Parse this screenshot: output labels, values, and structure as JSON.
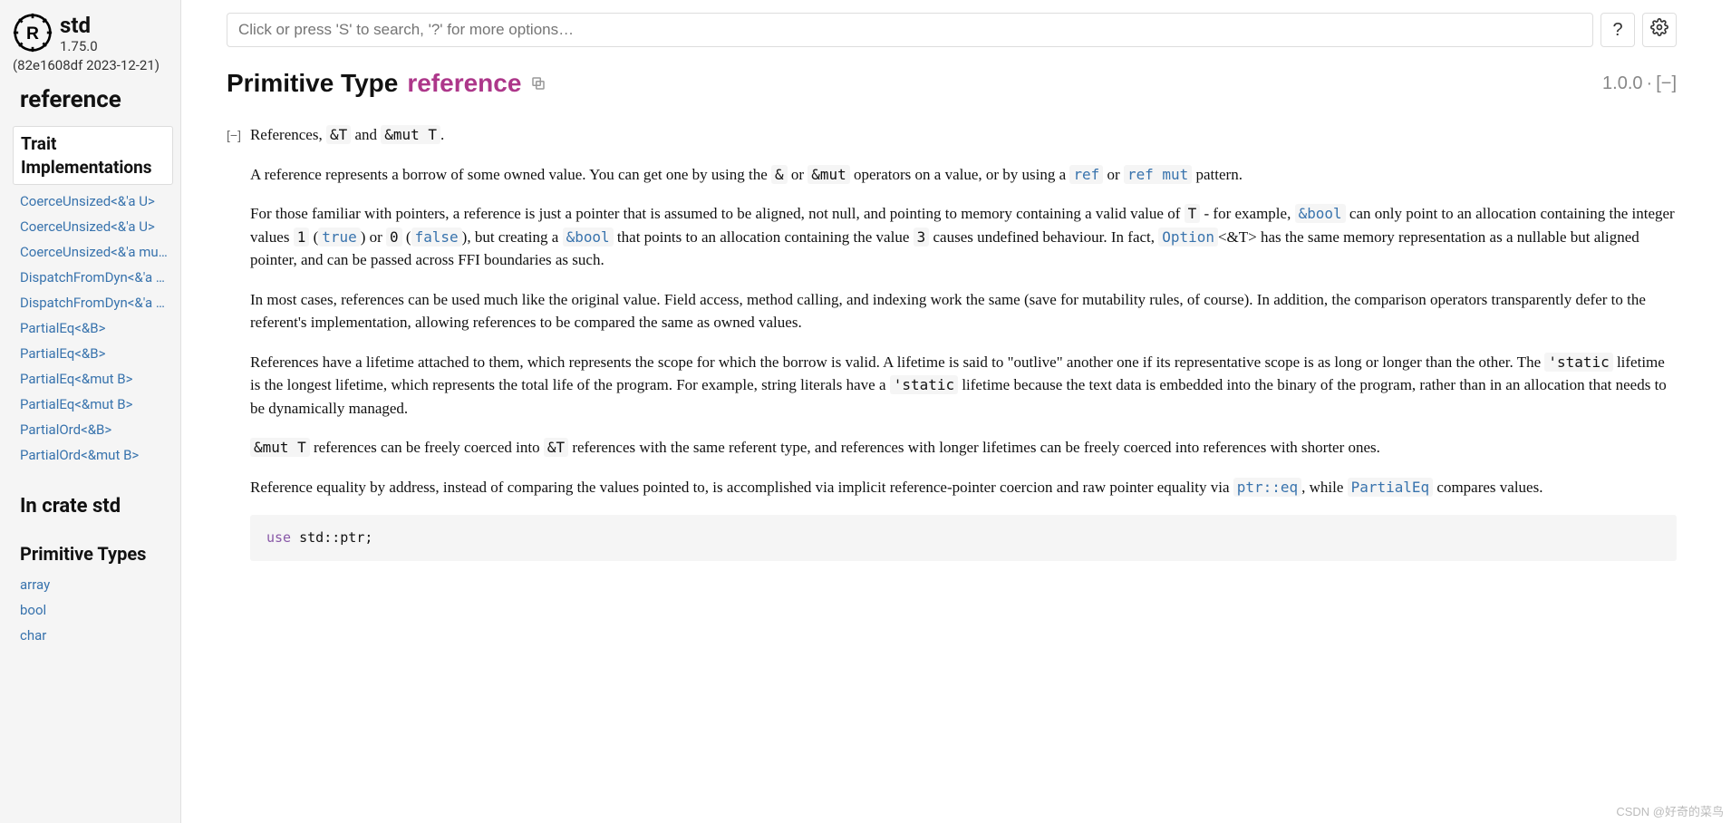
{
  "sidebar": {
    "crate": "std",
    "version": "1.75.0",
    "build": "(82e1608df 2023-12-21)",
    "page_heading": "reference",
    "active_section": "Trait Implementations",
    "trait_impls": [
      "CoerceUnsized<&'a U>",
      "CoerceUnsized<&'a U>",
      "CoerceUnsized<&'a mut…",
      "DispatchFromDyn<&'a U>",
      "DispatchFromDyn<&'a …",
      "PartialEq<&B>",
      "PartialEq<&B>",
      "PartialEq<&mut B>",
      "PartialEq<&mut B>",
      "PartialOrd<&B>",
      "PartialOrd<&mut B>"
    ],
    "in_crate_heading": "In crate std",
    "prim_heading": "Primitive Types",
    "prim_types": [
      "array",
      "bool",
      "char"
    ]
  },
  "search": {
    "placeholder": "Click or press 'S' to search, '?' for more options…"
  },
  "help_label": "?",
  "title": {
    "kind": "Primitive Type",
    "name": "reference"
  },
  "since": "1.0.0",
  "toggle_label": "[−]",
  "summary_pre": "References, ",
  "summary_code1": "&T",
  "summary_mid": " and ",
  "summary_code2": "&mut T",
  "summary_post": ".",
  "p1": {
    "t1": "A reference represents a borrow of some owned value. You can get one by using the ",
    "c1": "&",
    "t2": " or ",
    "c2": "&mut",
    "t3": " operators on a value, or by using a ",
    "c3": "ref",
    "t4": " or ",
    "c4": "ref mut",
    "t5": " pattern."
  },
  "p2": {
    "t1": "For those familiar with pointers, a reference is just a pointer that is assumed to be aligned, not null, and pointing to memory containing a valid value of ",
    "c1": "T",
    "t2": " - for example, ",
    "c2": "&bool",
    "t3": " can only point to an allocation containing the integer values ",
    "c3": "1",
    "t4": " (",
    "c4": "true",
    "t5": ") or ",
    "c5": "0",
    "t6": " (",
    "c6": "false",
    "t7": "), but creating a ",
    "c7": "&bool",
    "t8": " that points to an allocation containing the value ",
    "c8": "3",
    "t9": " causes undefined behaviour. In fact, ",
    "c9": "Option",
    "t10": "<&T> has the same memory representation as a nullable but aligned pointer, and can be passed across FFI boundaries as such."
  },
  "p3": "In most cases, references can be used much like the original value. Field access, method calling, and indexing work the same (save for mutability rules, of course). In addition, the comparison operators transparently defer to the referent's implementation, allowing references to be compared the same as owned values.",
  "p4": {
    "t1": "References have a lifetime attached to them, which represents the scope for which the borrow is valid. A lifetime is said to \"outlive\" another one if its representative scope is as long or longer than the other. The ",
    "c1": "'static",
    "t2": " lifetime is the longest lifetime, which represents the total life of the program. For example, string literals have a ",
    "c2": "'static",
    "t3": " lifetime because the text data is embedded into the binary of the program, rather than in an allocation that needs to be dynamically managed."
  },
  "p5": {
    "c1": "&mut T",
    "t1": " references can be freely coerced into ",
    "c2": "&T",
    "t2": " references with the same referent type, and references with longer lifetimes can be freely coerced into references with shorter ones."
  },
  "p6": {
    "t1": "Reference equality by address, instead of comparing the values pointed to, is accomplished via implicit reference-pointer coercion and raw pointer equality via ",
    "c1": "ptr::eq",
    "t2": ", while ",
    "c2": "PartialEq",
    "t3": " compares values."
  },
  "code1": {
    "kw": "use",
    "rest": " std::ptr;"
  },
  "watermark": "CSDN @好奇的菜鸟"
}
